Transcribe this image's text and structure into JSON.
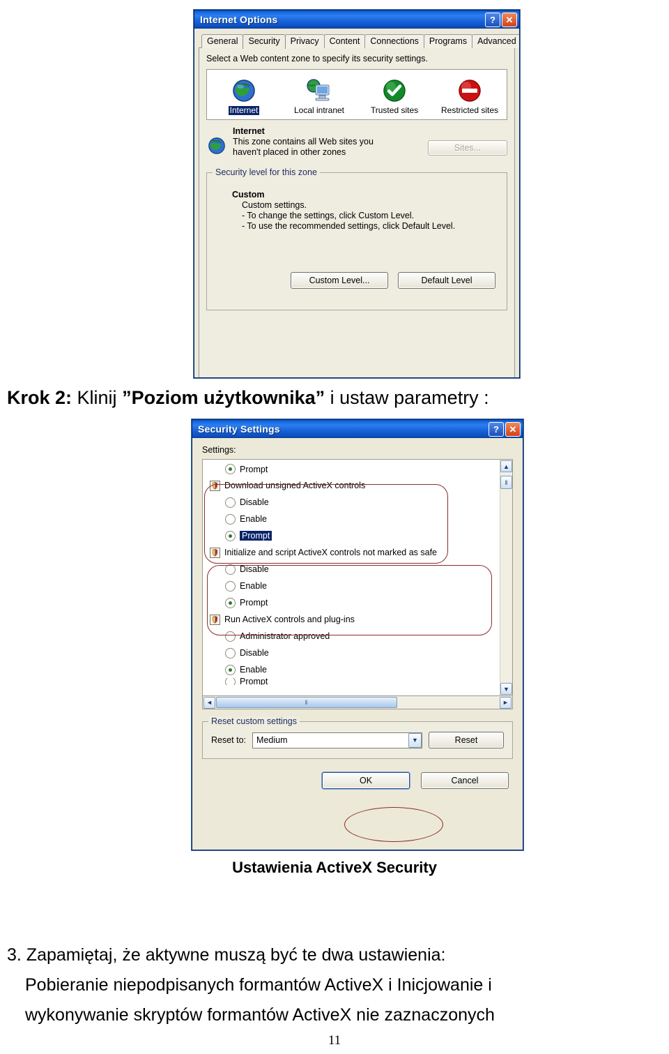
{
  "internet_options": {
    "title": "Internet Options",
    "help_glyph": "?",
    "close_glyph": "✕",
    "tabs": [
      {
        "label": "General",
        "selected": false
      },
      {
        "label": "Security",
        "selected": true
      },
      {
        "label": "Privacy",
        "selected": false
      },
      {
        "label": "Content",
        "selected": false
      },
      {
        "label": "Connections",
        "selected": false
      },
      {
        "label": "Programs",
        "selected": false
      },
      {
        "label": "Advanced",
        "selected": false
      }
    ],
    "zone_prompt": "Select a Web content zone to specify its security settings.",
    "zones": [
      {
        "label": "Internet",
        "icon": "globe-icon",
        "selected": true
      },
      {
        "label": "Local intranet",
        "icon": "intranet-computer-icon",
        "selected": false
      },
      {
        "label": "Trusted sites",
        "icon": "green-check-icon",
        "selected": false
      },
      {
        "label": "Restricted sites",
        "icon": "red-prohibited-icon",
        "selected": false
      }
    ],
    "zone_detail": {
      "icon": "globe-icon",
      "name": "Internet",
      "description_line1": "This zone contains all Web sites you",
      "description_line2": "haven't placed in other zones",
      "sites_button": "Sites..."
    },
    "security_level": {
      "legend": "Security level for this zone",
      "level_name": "Custom",
      "line1": "Custom settings.",
      "line2": "- To change the settings, click Custom Level.",
      "line3": "- To use the recommended settings, click Default Level.",
      "custom_level_button": "Custom Level...",
      "default_level_button": "Default Level"
    }
  },
  "step_heading": {
    "prefix": "Krok 2:",
    "mid": " Klinij ",
    "quoted": "”Poziom użytkownika”",
    "suffix": " i ustaw parametry :"
  },
  "security_settings": {
    "title": "Security Settings",
    "help_glyph": "?",
    "close_glyph": "✕",
    "settings_label": "Settings:",
    "items": [
      {
        "type": "option",
        "label": "Prompt",
        "checked": true,
        "highlighted": false,
        "partial": true
      },
      {
        "type": "header",
        "label": "Download unsigned ActiveX controls",
        "icon": "shield-icon"
      },
      {
        "type": "option",
        "label": "Disable",
        "checked": false,
        "highlighted": false
      },
      {
        "type": "option",
        "label": "Enable",
        "checked": false,
        "highlighted": false
      },
      {
        "type": "option",
        "label": "Prompt",
        "checked": true,
        "highlighted": true
      },
      {
        "type": "header",
        "label": "Initialize and script ActiveX controls not marked as safe",
        "icon": "shield-icon"
      },
      {
        "type": "option",
        "label": "Disable",
        "checked": false,
        "highlighted": false
      },
      {
        "type": "option",
        "label": "Enable",
        "checked": false,
        "highlighted": false
      },
      {
        "type": "option",
        "label": "Prompt",
        "checked": true,
        "highlighted": false
      },
      {
        "type": "header",
        "label": "Run ActiveX controls and plug-ins",
        "icon": "shield-icon"
      },
      {
        "type": "option",
        "label": "Administrator approved",
        "checked": false,
        "highlighted": false
      },
      {
        "type": "option",
        "label": "Disable",
        "checked": false,
        "highlighted": false
      },
      {
        "type": "option",
        "label": "Enable",
        "checked": true,
        "highlighted": false
      },
      {
        "type": "option",
        "label": "Prompt",
        "checked": false,
        "highlighted": false,
        "partial": true
      }
    ],
    "scroll": {
      "up_glyph": "▲",
      "down_glyph": "▼",
      "left_glyph": "◄",
      "right_glyph": "►",
      "grip_glyph": "‖"
    },
    "reset_group": {
      "legend": "Reset custom settings",
      "reset_to_label": "Reset to:",
      "reset_to_value": "Medium",
      "reset_button": "Reset",
      "dropdown_glyph": "▼"
    },
    "ok_button": "OK",
    "cancel_button": "Cancel"
  },
  "caption": "Ustawienia ActiveX Security",
  "paragraph": {
    "line1": "3. Zapamiętaj, że aktywne muszą być te dwa ustawienia:",
    "line2": "Pobieranie niepodpisanych formantów ActiveX i Inicjowanie i",
    "line3": "wykonywanie skryptów formantów ActiveX nie zaznaczonych"
  },
  "page_number": "11",
  "colors": {
    "titlebar_blue": "#1a6be0",
    "dialog_face": "#ece9d8",
    "selection_blue": "#0a246a",
    "annotation_red": "#8d2b2b"
  }
}
